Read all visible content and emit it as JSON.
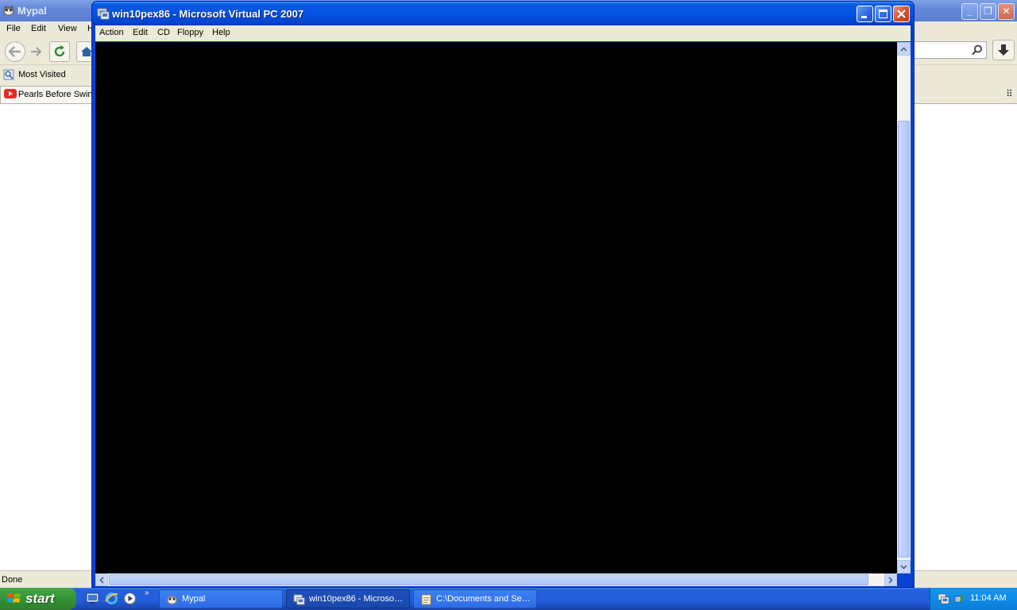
{
  "background_window": {
    "title": "Mypal",
    "menu": [
      "File",
      "Edit",
      "View",
      "H"
    ],
    "bookmarks": {
      "most_visited": "Most Visited"
    },
    "tab": {
      "label": "Pearls Before Swine"
    },
    "status": "Done"
  },
  "vpc_window": {
    "title": "win10pex86 - Microsoft Virtual PC 2007",
    "menu": [
      "Action",
      "Edit",
      "CD",
      "Floppy",
      "Help"
    ],
    "screen_color": "#000000"
  },
  "taskbar": {
    "start_label": "start",
    "quick_launch_icons": [
      "show-desktop-icon",
      "internet-explorer-icon",
      "media-player-icon"
    ],
    "tasks": [
      {
        "label": "Mypal",
        "icon": "mypal-icon",
        "active": false
      },
      {
        "label": "win10pex86 - Microso…",
        "icon": "virtual-pc-icon",
        "active": true
      },
      {
        "label": "C:\\Documents and Se…",
        "icon": "notepad-icon",
        "active": false
      }
    ],
    "clock": "11:04 AM"
  },
  "colors": {
    "xp_titlebar_blue": "#0553e3",
    "taskbar_blue": "#245edb",
    "start_green": "#3c9a3c",
    "close_red": "#d24d2d"
  }
}
